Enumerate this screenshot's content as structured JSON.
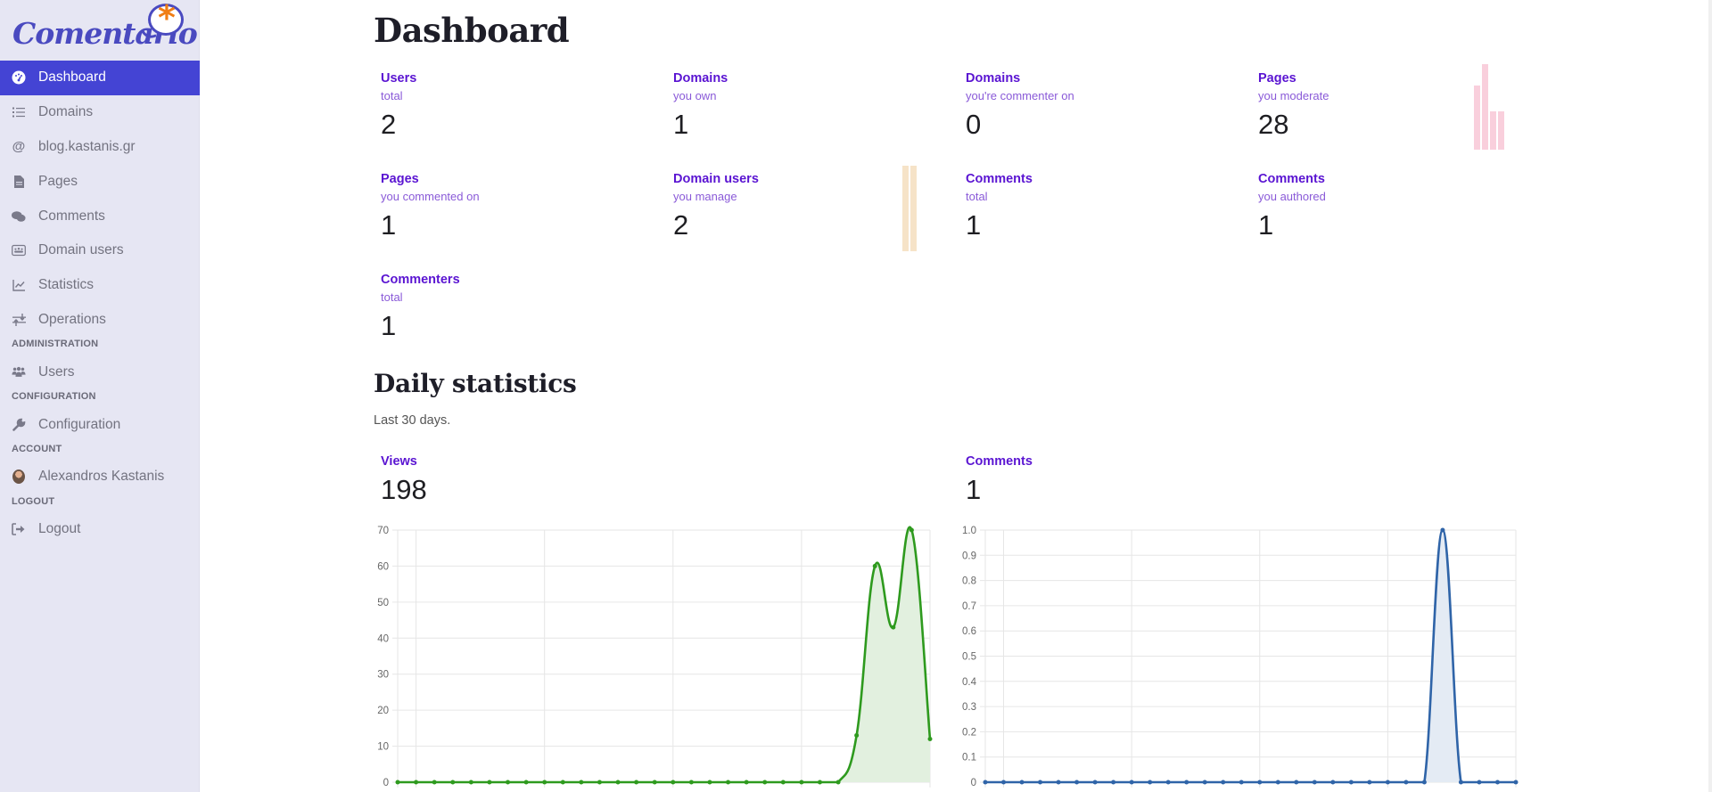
{
  "app": {
    "logo_text": "Comentario",
    "logo_mark": "*"
  },
  "sidebar": {
    "items": [
      {
        "id": "dashboard",
        "label": "Dashboard",
        "icon": "dashboard-gauge-icon",
        "active": true
      },
      {
        "id": "domains",
        "label": "Domains",
        "icon": "list-icon"
      },
      {
        "id": "domain",
        "label": "blog.kastanis.gr",
        "icon": "at-icon"
      },
      {
        "id": "pages",
        "label": "Pages",
        "icon": "file-icon"
      },
      {
        "id": "comments",
        "label": "Comments",
        "icon": "comments-icon"
      },
      {
        "id": "domain-users",
        "label": "Domain users",
        "icon": "users-rectangle-icon"
      },
      {
        "id": "statistics",
        "label": "Statistics",
        "icon": "chart-line-icon"
      },
      {
        "id": "operations",
        "label": "Operations",
        "icon": "arrows-up-down-icon"
      }
    ],
    "administration_heading": "ADMINISTRATION",
    "users_label": "Users",
    "configuration_heading": "CONFIGURATION",
    "configuration_label": "Configuration",
    "account_heading": "ACCOUNT",
    "account_name": "Alexandros Kastanis",
    "logout_heading": "LOGOUT",
    "logout_label": "Logout"
  },
  "dashboard": {
    "title": "Dashboard",
    "cards": [
      {
        "title": "Users",
        "subtitle": "total",
        "value": "2"
      },
      {
        "title": "Domains",
        "subtitle": "you own",
        "value": "1"
      },
      {
        "title": "Domains",
        "subtitle": "you're commenter on",
        "value": "0"
      },
      {
        "title": "Pages",
        "subtitle": "you moderate",
        "value": "28",
        "mini_chart": {
          "color": "#f9cfdc",
          "values": [
            0.75,
            1.0,
            0.45,
            0.45
          ]
        }
      },
      {
        "title": "Pages",
        "subtitle": "you commented on",
        "value": "1"
      },
      {
        "title": "Domain users",
        "subtitle": "you manage",
        "value": "2",
        "mini_chart": {
          "color": "#f6e3c8",
          "values": [
            1,
            1
          ]
        }
      },
      {
        "title": "Comments",
        "subtitle": "total",
        "value": "1"
      },
      {
        "title": "Comments",
        "subtitle": "you authored",
        "value": "1"
      },
      {
        "title": "Commenters",
        "subtitle": "total",
        "value": "1"
      }
    ]
  },
  "daily": {
    "title": "Daily statistics",
    "subtitle": "Last 30 days.",
    "views": {
      "title": "Views",
      "total": "198"
    },
    "comments": {
      "title": "Comments",
      "total": "1"
    }
  },
  "chart_data": [
    {
      "type": "area",
      "title": "Views",
      "xlabel": "",
      "ylabel": "",
      "ylim": [
        0,
        70
      ],
      "yticks": [
        0,
        10,
        20,
        30,
        40,
        50,
        60,
        70
      ],
      "ytick_labels": [
        "0",
        "10",
        "20",
        "30",
        "40",
        "50",
        "60",
        "70"
      ],
      "grid": true,
      "color": "#2e9a1e",
      "fill": "#e2f0df",
      "values": [
        0,
        0,
        0,
        0,
        0,
        0,
        0,
        0,
        0,
        0,
        0,
        0,
        0,
        0,
        0,
        0,
        0,
        0,
        0,
        0,
        0,
        0,
        0,
        0,
        0,
        13,
        60,
        43,
        70,
        12
      ]
    },
    {
      "type": "area",
      "title": "Comments",
      "xlabel": "",
      "ylabel": "",
      "ylim": [
        0,
        1
      ],
      "yticks": [
        0,
        0.1,
        0.2,
        0.3,
        0.4,
        0.5,
        0.6,
        0.7,
        0.8,
        0.9,
        1.0
      ],
      "ytick_labels": [
        "0",
        "0.1",
        "0.2",
        "0.3",
        "0.4",
        "0.5",
        "0.6",
        "0.7",
        "0.8",
        "0.9",
        "1.0"
      ],
      "grid": true,
      "color": "#2f64a8",
      "fill": "#e4ebf4",
      "values": [
        0,
        0,
        0,
        0,
        0,
        0,
        0,
        0,
        0,
        0,
        0,
        0,
        0,
        0,
        0,
        0,
        0,
        0,
        0,
        0,
        0,
        0,
        0,
        0,
        0,
        1,
        0,
        0,
        0,
        0
      ]
    }
  ]
}
